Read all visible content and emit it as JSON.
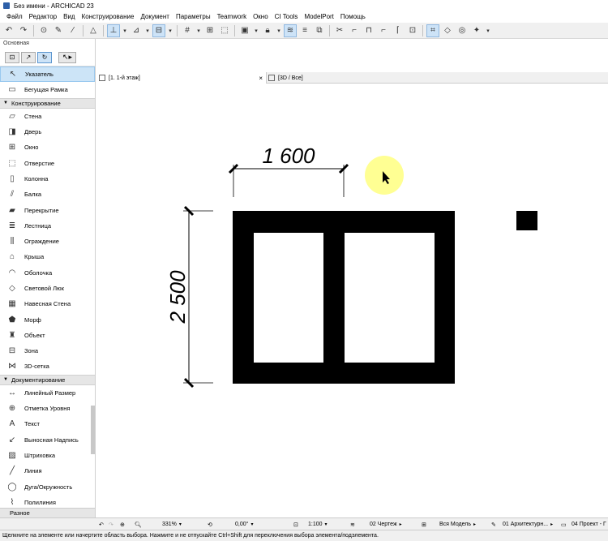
{
  "window": {
    "title": "Без имени - ARCHICAD 23"
  },
  "menu": [
    "Файл",
    "Редактор",
    "Вид",
    "Конструирование",
    "Документ",
    "Параметры",
    "Teamwork",
    "Окно",
    "CI Tools",
    "ModelPort",
    "Помощь"
  ],
  "toolbox": {
    "header": "Основная",
    "tools_top": [
      {
        "label": "Указатель",
        "icon": "arrow-pointer-icon",
        "selected": true
      },
      {
        "label": "Бегущая Рамка",
        "icon": "marquee-icon",
        "selected": false
      }
    ],
    "groups": [
      {
        "label": "Конструирование",
        "tools": [
          {
            "label": "Стена",
            "icon": "wall-icon"
          },
          {
            "label": "Дверь",
            "icon": "door-icon"
          },
          {
            "label": "Окно",
            "icon": "window-icon"
          },
          {
            "label": "Отверстие",
            "icon": "opening-icon"
          },
          {
            "label": "Колонна",
            "icon": "column-icon"
          },
          {
            "label": "Балка",
            "icon": "beam-icon"
          },
          {
            "label": "Перекрытие",
            "icon": "slab-icon"
          },
          {
            "label": "Лестница",
            "icon": "stair-icon"
          },
          {
            "label": "Ограждение",
            "icon": "railing-icon"
          },
          {
            "label": "Крыша",
            "icon": "roof-icon"
          },
          {
            "label": "Оболочка",
            "icon": "shell-icon"
          },
          {
            "label": "Световой Люк",
            "icon": "skylight-icon"
          },
          {
            "label": "Навесная Стена",
            "icon": "curtain-wall-icon"
          },
          {
            "label": "Морф",
            "icon": "morph-icon"
          },
          {
            "label": "Объект",
            "icon": "object-icon"
          },
          {
            "label": "Зона",
            "icon": "zone-icon"
          },
          {
            "label": "3D-сетка",
            "icon": "mesh-icon"
          }
        ]
      },
      {
        "label": "Документирование",
        "tools": [
          {
            "label": "Линейный Размер",
            "icon": "dimension-icon"
          },
          {
            "label": "Отметка Уровня",
            "icon": "level-dimension-icon"
          },
          {
            "label": "Текст",
            "icon": "text-icon"
          },
          {
            "label": "Выносная Надпись",
            "icon": "label-icon"
          },
          {
            "label": "Штриховка",
            "icon": "fill-icon"
          },
          {
            "label": "Линия",
            "icon": "line-icon"
          },
          {
            "label": "Дуга/Окружность",
            "icon": "arc-icon"
          },
          {
            "label": "Полилиния",
            "icon": "polyline-icon"
          }
        ]
      }
    ],
    "bottom_group": "Разное"
  },
  "tabs": [
    {
      "label": "[1. 1-й этаж]",
      "active": true
    },
    {
      "label": "[3D / Все]",
      "active": false
    }
  ],
  "drawing": {
    "dim_horizontal": "1 600",
    "dim_vertical": "2 500"
  },
  "status": {
    "zoom": "331%",
    "angle": "0,00°",
    "scale": "1:100",
    "layer_combo": "02 Чертеж",
    "model_view": "Вся Модель",
    "pen_set": "01 Архитектурн...",
    "renovation": "04 Проект - Г"
  },
  "message": "Щелкните на элементе или начертите область выбора. Нажмите и не отпускайте Ctrl+Shift для переключения выбора элемента/подэлемента."
}
